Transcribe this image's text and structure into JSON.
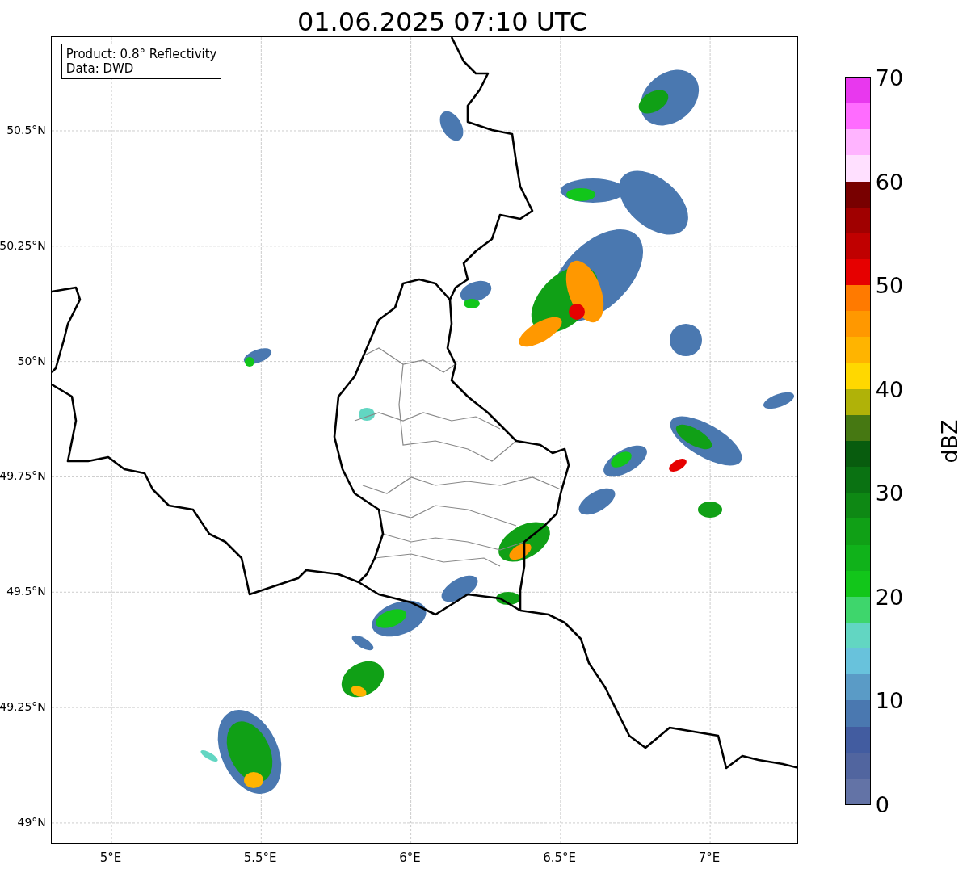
{
  "title": "01.06.2025 07:10 UTC",
  "annotation": [
    "Product: 0.8° Reflectivity",
    "Data: DWD"
  ],
  "map": {
    "x_tick_labels": [
      "5°E",
      "5.5°E",
      "6°E",
      "6.5°E",
      "7°E"
    ],
    "y_tick_labels": [
      "50.5°N",
      "50.25°N",
      "50°N",
      "49.75°N",
      "49.5°N",
      "49.25°N",
      "49°N"
    ]
  },
  "colorbar": {
    "label": "dBZ",
    "tick_labels": [
      "70",
      "60",
      "50",
      "40",
      "30",
      "20",
      "10",
      "0"
    ],
    "bins": [
      {
        "color": "#6373a6"
      },
      {
        "color": "#51659f"
      },
      {
        "color": "#425ca0"
      },
      {
        "color": "#4a78b0"
      },
      {
        "color": "#5a9bc6"
      },
      {
        "color": "#68c2dc"
      },
      {
        "color": "#62d6c2"
      },
      {
        "color": "#3ed66c"
      },
      {
        "color": "#12c61a"
      },
      {
        "color": "#10b21a"
      },
      {
        "color": "#10a016"
      },
      {
        "color": "#0e8814"
      },
      {
        "color": "#0a7212"
      },
      {
        "color": "#085c0e"
      },
      {
        "color": "#467812"
      },
      {
        "color": "#b0b208"
      },
      {
        "color": "#ffd800"
      },
      {
        "color": "#ffb400"
      },
      {
        "color": "#ff9800"
      },
      {
        "color": "#ff7a00"
      },
      {
        "color": "#e60000"
      },
      {
        "color": "#c00000"
      },
      {
        "color": "#a00000"
      },
      {
        "color": "#780000"
      },
      {
        "color": "#ffe0ff"
      },
      {
        "color": "#ffb4ff"
      },
      {
        "color": "#ff6cff"
      },
      {
        "color": "#e838ee"
      }
    ]
  }
}
